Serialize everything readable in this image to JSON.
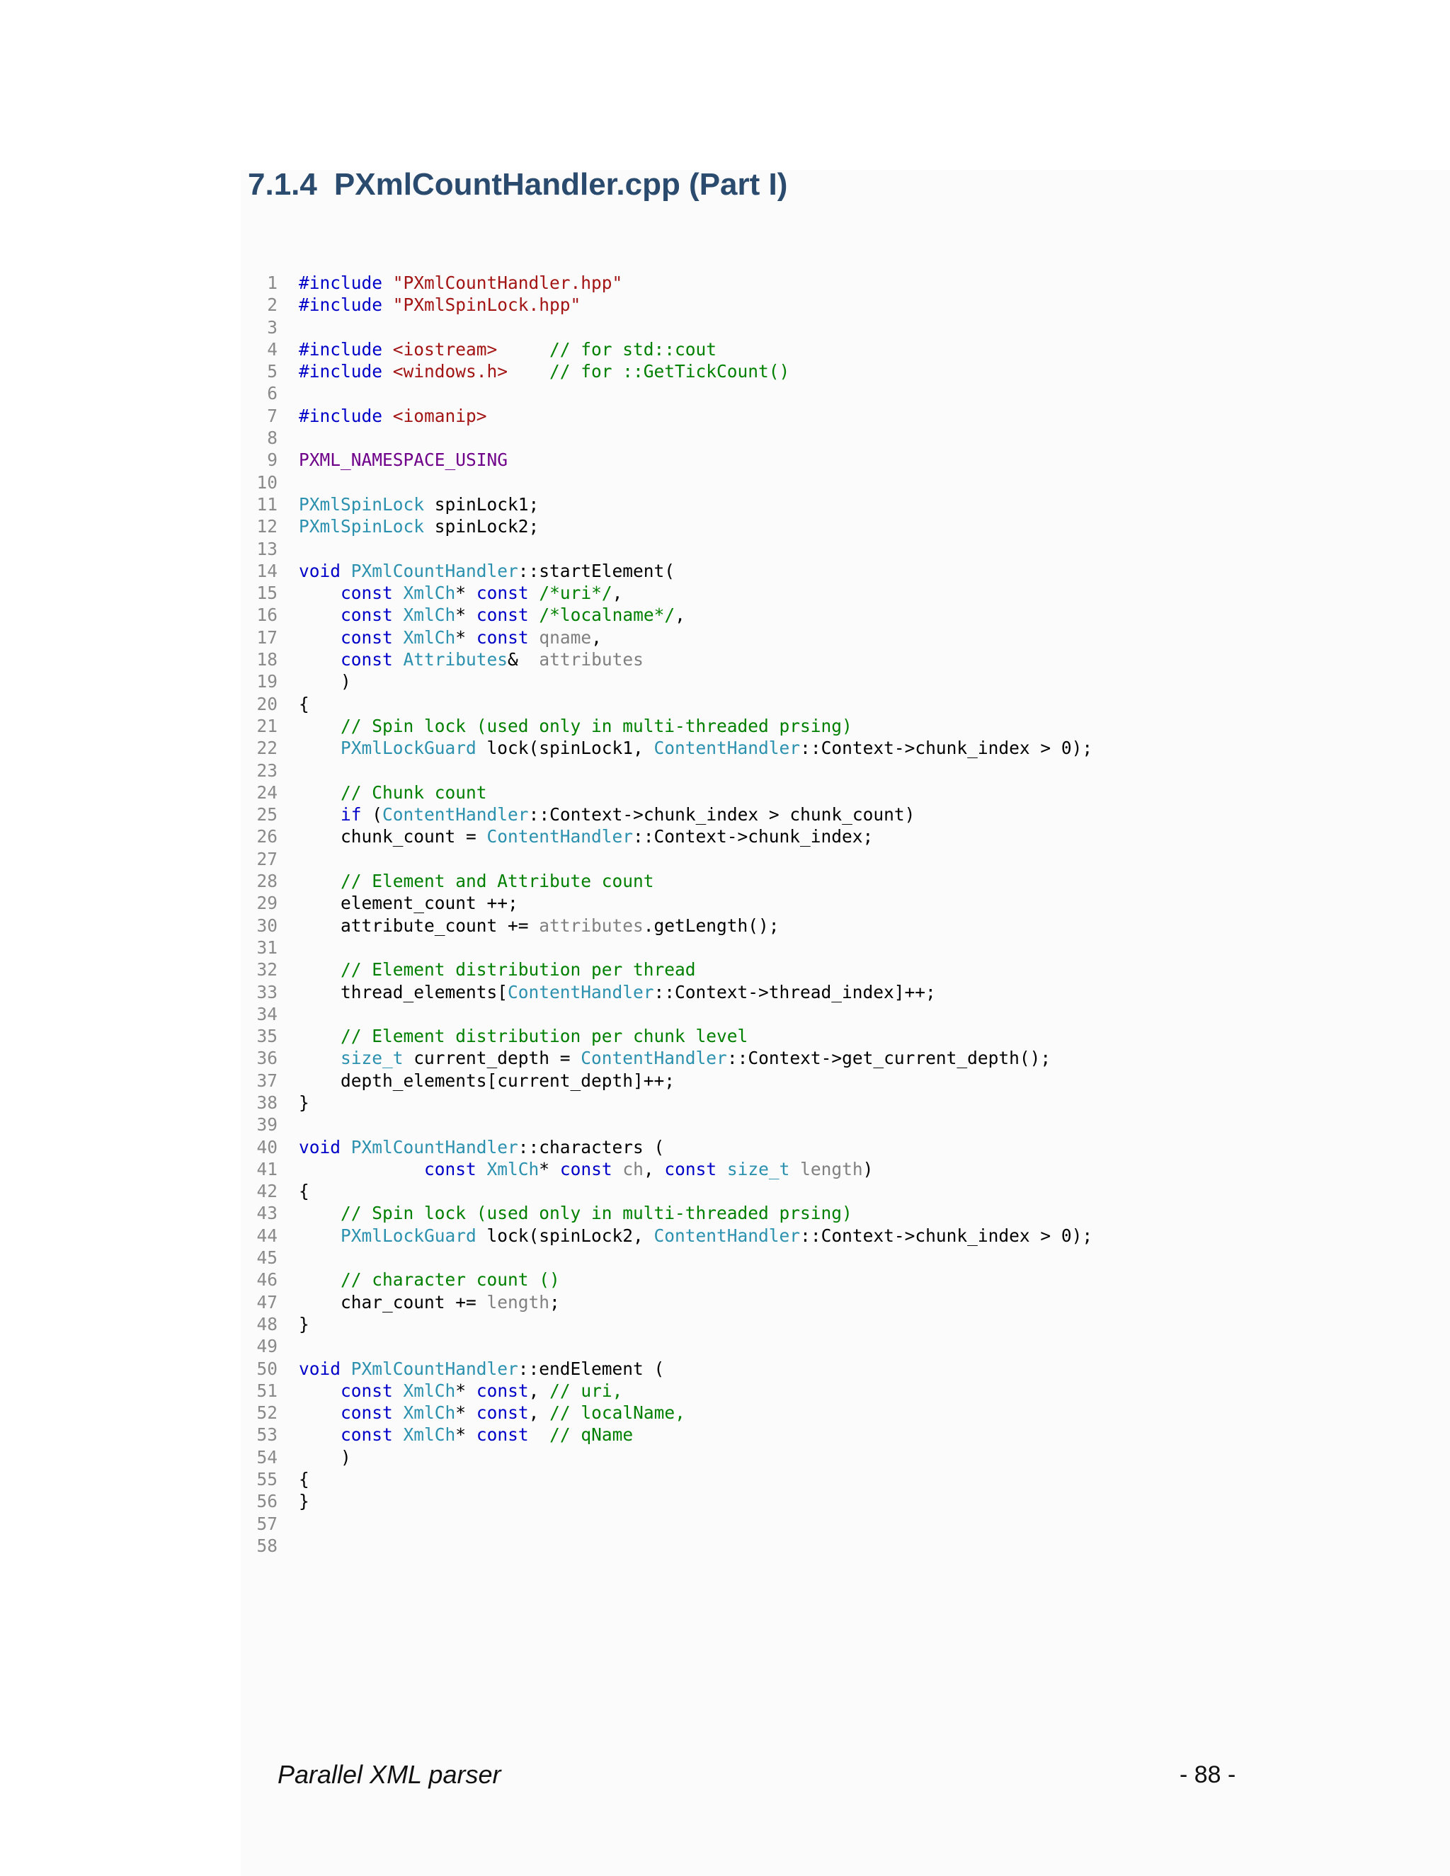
{
  "section": {
    "number": "7.1.4",
    "title": "PXmlCountHandler.cpp (Part I)"
  },
  "footer": {
    "left": "Parallel XML parser",
    "right": "- 88 -"
  },
  "colors": {
    "keyword": "#0000c8",
    "string": "#a31515",
    "comment": "#008000",
    "type": "#2b91af",
    "macro": "#6f008a",
    "parameter": "#808080",
    "heading": "#2a4b6e"
  },
  "code_lines": [
    [
      [
        "kw",
        "#include "
      ],
      [
        "str",
        "\"PXmlCountHandler.hpp\""
      ]
    ],
    [
      [
        "kw",
        "#include "
      ],
      [
        "str",
        "\"PXmlSpinLock.hpp\""
      ]
    ],
    [],
    [
      [
        "kw",
        "#include "
      ],
      [
        "str",
        "<iostream>"
      ],
      [
        "plain",
        "     "
      ],
      [
        "cm",
        "// for std::cout"
      ]
    ],
    [
      [
        "kw",
        "#include "
      ],
      [
        "str",
        "<windows.h>"
      ],
      [
        "plain",
        "    "
      ],
      [
        "cm",
        "// for ::GetTickCount()"
      ]
    ],
    [],
    [
      [
        "kw",
        "#include "
      ],
      [
        "str",
        "<iomanip>"
      ]
    ],
    [],
    [
      [
        "macro",
        "PXML_NAMESPACE_USING"
      ]
    ],
    [],
    [
      [
        "type",
        "PXmlSpinLock"
      ],
      [
        "plain",
        " spinLock1;"
      ]
    ],
    [
      [
        "type",
        "PXmlSpinLock"
      ],
      [
        "plain",
        " spinLock2;"
      ]
    ],
    [],
    [
      [
        "kw",
        "void "
      ],
      [
        "type",
        "PXmlCountHandler"
      ],
      [
        "plain",
        "::startElement("
      ]
    ],
    [
      [
        "plain",
        "    "
      ],
      [
        "kw",
        "const "
      ],
      [
        "type",
        "XmlCh"
      ],
      [
        "plain",
        "* "
      ],
      [
        "kw",
        "const "
      ],
      [
        "cm",
        "/*uri*/"
      ],
      [
        "plain",
        ","
      ]
    ],
    [
      [
        "plain",
        "    "
      ],
      [
        "kw",
        "const "
      ],
      [
        "type",
        "XmlCh"
      ],
      [
        "plain",
        "* "
      ],
      [
        "kw",
        "const "
      ],
      [
        "cm",
        "/*localname*/"
      ],
      [
        "plain",
        ","
      ]
    ],
    [
      [
        "plain",
        "    "
      ],
      [
        "kw",
        "const "
      ],
      [
        "type",
        "XmlCh"
      ],
      [
        "plain",
        "* "
      ],
      [
        "kw",
        "const "
      ],
      [
        "param",
        "qname"
      ],
      [
        "plain",
        ","
      ]
    ],
    [
      [
        "plain",
        "    "
      ],
      [
        "kw",
        "const "
      ],
      [
        "type",
        "Attributes"
      ],
      [
        "plain",
        "&  "
      ],
      [
        "param",
        "attributes"
      ]
    ],
    [
      [
        "plain",
        "    )"
      ]
    ],
    [
      [
        "plain",
        "{"
      ]
    ],
    [
      [
        "plain",
        "    "
      ],
      [
        "cm",
        "// Spin lock (used only in multi-threaded prsing)"
      ]
    ],
    [
      [
        "plain",
        "    "
      ],
      [
        "type",
        "PXmlLockGuard"
      ],
      [
        "plain",
        " lock(spinLock1, "
      ],
      [
        "type",
        "ContentHandler"
      ],
      [
        "plain",
        "::Context->chunk_index > 0);"
      ]
    ],
    [],
    [
      [
        "plain",
        "    "
      ],
      [
        "cm",
        "// Chunk count"
      ]
    ],
    [
      [
        "plain",
        "    "
      ],
      [
        "kw",
        "if"
      ],
      [
        "plain",
        " ("
      ],
      [
        "type",
        "ContentHandler"
      ],
      [
        "plain",
        "::Context->chunk_index > chunk_count)"
      ]
    ],
    [
      [
        "plain",
        "    chunk_count = "
      ],
      [
        "type",
        "ContentHandler"
      ],
      [
        "plain",
        "::Context->chunk_index;"
      ]
    ],
    [],
    [
      [
        "plain",
        "    "
      ],
      [
        "cm",
        "// Element and Attribute count"
      ]
    ],
    [
      [
        "plain",
        "    element_count ++;"
      ]
    ],
    [
      [
        "plain",
        "    attribute_count += "
      ],
      [
        "param",
        "attributes"
      ],
      [
        "plain",
        ".getLength();"
      ]
    ],
    [],
    [
      [
        "plain",
        "    "
      ],
      [
        "cm",
        "// Element distribution per thread"
      ]
    ],
    [
      [
        "plain",
        "    thread_elements["
      ],
      [
        "type",
        "ContentHandler"
      ],
      [
        "plain",
        "::Context->thread_index]++;"
      ]
    ],
    [],
    [
      [
        "plain",
        "    "
      ],
      [
        "cm",
        "// Element distribution per chunk level"
      ]
    ],
    [
      [
        "plain",
        "    "
      ],
      [
        "type",
        "size_t"
      ],
      [
        "plain",
        " current_depth = "
      ],
      [
        "type",
        "ContentHandler"
      ],
      [
        "plain",
        "::Context->get_current_depth();"
      ]
    ],
    [
      [
        "plain",
        "    depth_elements[current_depth]++;"
      ]
    ],
    [
      [
        "plain",
        "}"
      ]
    ],
    [],
    [
      [
        "kw",
        "void "
      ],
      [
        "type",
        "PXmlCountHandler"
      ],
      [
        "plain",
        "::characters ("
      ]
    ],
    [
      [
        "plain",
        "            "
      ],
      [
        "kw",
        "const "
      ],
      [
        "type",
        "XmlCh"
      ],
      [
        "plain",
        "* "
      ],
      [
        "kw",
        "const "
      ],
      [
        "param",
        "ch"
      ],
      [
        "plain",
        ", "
      ],
      [
        "kw",
        "const "
      ],
      [
        "type",
        "size_t"
      ],
      [
        "plain",
        " "
      ],
      [
        "param",
        "length"
      ],
      [
        "plain",
        ")"
      ]
    ],
    [
      [
        "plain",
        "{"
      ]
    ],
    [
      [
        "plain",
        "    "
      ],
      [
        "cm",
        "// Spin lock (used only in multi-threaded prsing)"
      ]
    ],
    [
      [
        "plain",
        "    "
      ],
      [
        "type",
        "PXmlLockGuard"
      ],
      [
        "plain",
        " lock(spinLock2, "
      ],
      [
        "type",
        "ContentHandler"
      ],
      [
        "plain",
        "::Context->chunk_index > 0);"
      ]
    ],
    [],
    [
      [
        "plain",
        "    "
      ],
      [
        "cm",
        "// character count ()"
      ]
    ],
    [
      [
        "plain",
        "    char_count += "
      ],
      [
        "param",
        "length"
      ],
      [
        "plain",
        ";"
      ]
    ],
    [
      [
        "plain",
        "}"
      ]
    ],
    [],
    [
      [
        "kw",
        "void "
      ],
      [
        "type",
        "PXmlCountHandler"
      ],
      [
        "plain",
        "::endElement ("
      ]
    ],
    [
      [
        "plain",
        "    "
      ],
      [
        "kw",
        "const "
      ],
      [
        "type",
        "XmlCh"
      ],
      [
        "plain",
        "* "
      ],
      [
        "kw",
        "const"
      ],
      [
        "plain",
        ", "
      ],
      [
        "cm",
        "// uri,"
      ]
    ],
    [
      [
        "plain",
        "    "
      ],
      [
        "kw",
        "const "
      ],
      [
        "type",
        "XmlCh"
      ],
      [
        "plain",
        "* "
      ],
      [
        "kw",
        "const"
      ],
      [
        "plain",
        ", "
      ],
      [
        "cm",
        "// localName,"
      ]
    ],
    [
      [
        "plain",
        "    "
      ],
      [
        "kw",
        "const "
      ],
      [
        "type",
        "XmlCh"
      ],
      [
        "plain",
        "* "
      ],
      [
        "kw",
        "const"
      ],
      [
        "plain",
        "  "
      ],
      [
        "cm",
        "// qName"
      ]
    ],
    [
      [
        "plain",
        "    )"
      ]
    ],
    [
      [
        "plain",
        "{"
      ]
    ],
    [
      [
        "plain",
        "}"
      ]
    ],
    [],
    []
  ]
}
